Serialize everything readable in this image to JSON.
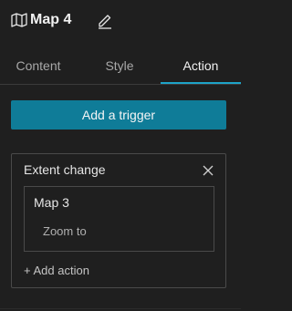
{
  "header": {
    "icon": "map-book-icon",
    "title": "Map 4",
    "edit_icon": "pencil-icon"
  },
  "tabs": [
    {
      "label": "Content",
      "active": false
    },
    {
      "label": "Style",
      "active": false
    },
    {
      "label": "Action",
      "active": true
    }
  ],
  "add_trigger_label": "Add a trigger",
  "trigger": {
    "title": "Extent change",
    "close_icon": "close-icon",
    "target": "Map 3",
    "action": "Zoom to",
    "add_action_label": "+ Add action"
  },
  "colors": {
    "background": "#1f1f1f",
    "accent": "#1ea4c8",
    "button": "#0f7c98"
  }
}
